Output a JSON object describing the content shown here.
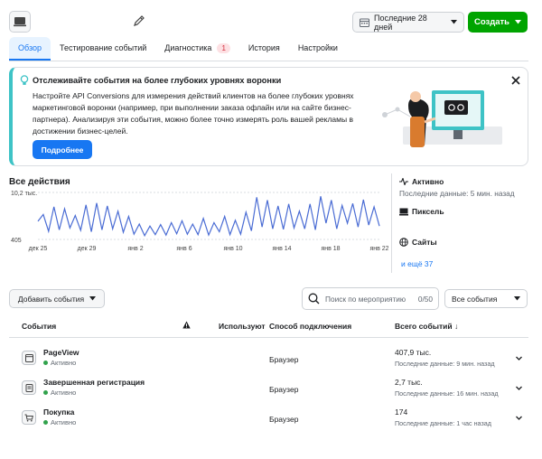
{
  "header": {
    "date_range": "Последние 28 дней",
    "create_label": "Создать"
  },
  "tabs": [
    {
      "label": "Обзор",
      "active": true
    },
    {
      "label": "Тестирование событий"
    },
    {
      "label": "Диагностика",
      "badge": "1"
    },
    {
      "label": "История"
    },
    {
      "label": "Настройки"
    }
  ],
  "banner": {
    "title": "Отслеживайте события на более глубоких уровнях воронки",
    "body": "Настройте API Conversions для измерения действий клиентов на более глубоких уровнях маркетинговой воронки (например, при выполнении заказа офлайн или на сайте бизнес-партнера). Анализируя эти события, можно более точно измерять роль вашей рекламы в достижении бизнес-целей.",
    "button": "Подробнее"
  },
  "chart_section": {
    "title": "Все действия"
  },
  "chart_data": {
    "type": "line",
    "title": "Все действия",
    "y_ticks": [
      "10,2 тыс.",
      "405"
    ],
    "ylim": [
      405,
      10200
    ],
    "x_ticks": [
      "дек 25",
      "дек 29",
      "янв 2",
      "янв 6",
      "янв 10",
      "янв 14",
      "янв 18",
      "янв 22"
    ],
    "series": [
      {
        "color": "#4a6cd4",
        "values": [
          4200,
          5600,
          2100,
          7200,
          2400,
          6800,
          2800,
          5400,
          2300,
          7600,
          2000,
          8000,
          2400,
          7400,
          2600,
          6300,
          1900,
          5200,
          1500,
          3600,
          1200,
          3200,
          1400,
          3500,
          1300,
          3900,
          1600,
          4300,
          1500,
          3600,
          1400,
          4800,
          1300,
          3900,
          2000,
          5200,
          1400,
          4400,
          1500,
          6100,
          2200,
          9200,
          3000,
          8600,
          2600,
          7400,
          2500,
          7800,
          2800,
          6300,
          2600,
          7800,
          2400,
          9400,
          3800,
          8600,
          2600,
          7500,
          3800,
          7900,
          3000,
          8700,
          3400,
          7200,
          3200
        ]
      }
    ]
  },
  "sidebar": {
    "status_title": "Активно",
    "status_sub": "Последние данные: 5 мин. назад",
    "pixel_label": "Пиксель",
    "sites_label": "Сайты",
    "more_link": "и ещё 37"
  },
  "toolbar": {
    "add_events": "Добавить события",
    "search_placeholder": "Поиск по мероприятию",
    "search_count": "0/50",
    "filter": "Все события"
  },
  "table": {
    "headers": {
      "events": "События",
      "uses": "Используют",
      "method": "Способ подключения",
      "total": "Всего событий ↓"
    },
    "rows": [
      {
        "name": "PageView",
        "status": "Активно",
        "method": "Браузер",
        "total": "407,9 тыс.",
        "last": "Последние данные: 9 мин. назад",
        "icon": "page-icon"
      },
      {
        "name": "Завершенная регистрация",
        "status": "Активно",
        "method": "Браузер",
        "total": "2,7 тыс.",
        "last": "Последние данные: 16 мин. назад",
        "icon": "registration-icon"
      },
      {
        "name": "Покупка",
        "status": "Активно",
        "method": "Браузер",
        "total": "174",
        "last": "Последние данные: 1 час назад",
        "icon": "cart-icon"
      }
    ]
  }
}
